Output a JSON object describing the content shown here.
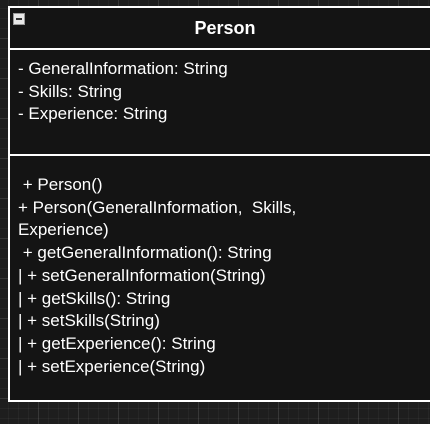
{
  "uml_class": {
    "name": "Person",
    "attributes": [
      "- GeneralInformation: String",
      "- Skills: String",
      "- Experience: String"
    ],
    "operations": [
      " + Person()",
      "+ Person(GeneralInformation,  Skills,",
      "Experience)",
      " + getGeneralInformation(): String",
      "| + setGeneralInformation(String)",
      "| + getSkills(): String",
      "| + setSkills(String)",
      "| + getExperience(): String",
      "| + setExperience(String)"
    ]
  }
}
